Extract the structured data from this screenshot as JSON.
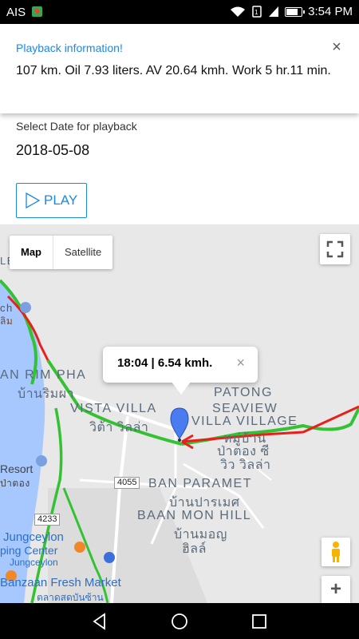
{
  "status_bar": {
    "carrier": "AIS",
    "time": "3:54 PM"
  },
  "playback_card": {
    "title": "Playback information!",
    "text": "107 km. Oil 7.93 liters. AV 20.64 kmh. Work 5 hr.11 min.",
    "close_symbol": "×"
  },
  "date_section": {
    "label": "Select Date for playback",
    "value": "2018-05-08"
  },
  "play_button": {
    "label": "PLAY"
  },
  "map": {
    "type_control": {
      "map": "Map",
      "satellite": "Satellite"
    },
    "infowindow": {
      "text": "18:04 | 6.54 kmh.",
      "close": "×"
    },
    "zoom_in": "+",
    "labels": {
      "ban_rim_pha": "AN RIM PHA",
      "ban_rim_pha_thai": "บ้านริมผา",
      "vista_villa": "VISTA VILLA",
      "vista_villa_thai": "วิต้า วิลล่า",
      "patong": "PATONG",
      "seaview": "SEAVIEW",
      "villa_village": "VILLA VILLAGE",
      "patong_thai_1": "หมู่บ้าน",
      "patong_thai_2": "ป่าตอง ซี",
      "patong_thai_3": "วิว วิลล่า",
      "ban_paramet": "BAN PARAMET",
      "ban_paramet_thai": "บ้านปารเมศ",
      "baan_mon_hill": "BAAN MON HILL",
      "baan_mon_hill_thai_1": "บ้านมอญ",
      "baan_mon_hill_thai_2": "ฮิลล์",
      "resort": "Resort",
      "resort_thai": "ป่าตอง",
      "ch": "ch",
      "thai_left": "ลิม",
      "jungceylon_1": "Jungceylon",
      "jungceylon_2": "ping Center",
      "jungceylon_3": "Jungceylon",
      "banzaan": "Banzaan Fresh Market",
      "banzaan_thai": "ตลาดสดบันซ้าน",
      "shield_4055": "4055",
      "shield_4233": "4233",
      "top_left": "LE"
    },
    "colors": {
      "traffic_green": "#34c234",
      "route_red": "#e8201c",
      "water": "#a6c8ff",
      "marker": "#4a7bf0"
    }
  },
  "nav_bar": {
    "back": "back-icon",
    "home": "home-icon",
    "recents": "recents-icon"
  }
}
